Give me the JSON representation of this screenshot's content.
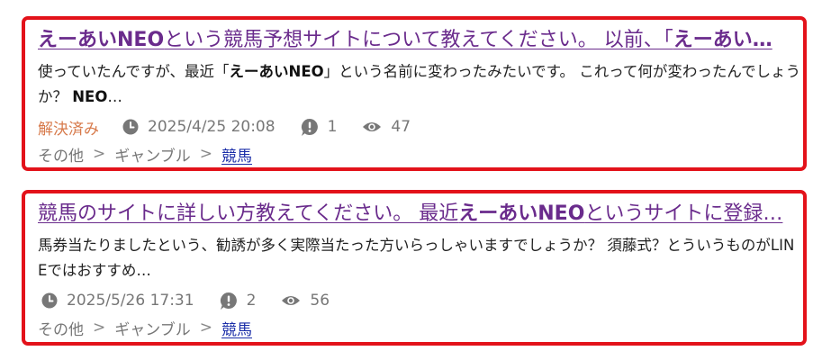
{
  "questions": [
    {
      "title_parts": [
        {
          "text": "えーあいNEO",
          "bold": true
        },
        {
          "text": "という競馬予想サイトについて教えてください。 以前、「",
          "bold": false
        },
        {
          "text": "えーあい…",
          "bold": true
        }
      ],
      "body_parts": [
        {
          "text": "使っていたんですが、最近「",
          "bold": false
        },
        {
          "text": "えーあいNEO",
          "bold": true
        },
        {
          "text": "」という名前に変わったみたいです。 これって何が変わったんでしょうか？ ",
          "bold": false
        },
        {
          "text": "NEO",
          "bold": true
        },
        {
          "text": "…",
          "bold": false
        }
      ],
      "status": "解決済み",
      "datetime": "2025/4/25 20:08",
      "answers": "1",
      "views": "47",
      "breadcrumb": [
        "その他",
        "ギャンブル",
        "競馬"
      ]
    },
    {
      "title_parts": [
        {
          "text": "競馬のサイトに詳しい方教えてください。 最近",
          "bold": false
        },
        {
          "text": "えーあいNEO",
          "bold": true
        },
        {
          "text": "というサイトに登録…",
          "bold": false
        }
      ],
      "body_parts": [
        {
          "text": "馬券当たりましたという、勧誘が多く実際当たった方いらっしゃいますでしょうか？ 須藤式？とういうものがLINEではおすすめ…",
          "bold": false
        }
      ],
      "status": "",
      "datetime": "2025/5/26 17:31",
      "answers": "2",
      "views": "56",
      "breadcrumb": [
        "その他",
        "ギャンブル",
        "競馬"
      ]
    }
  ],
  "breadcrumb_separator": ">",
  "colors": {
    "border": "#e3121a",
    "title": "#6a2b8c",
    "link": "#1a2da8",
    "resolved": "#d77a4b",
    "meta": "#777777"
  },
  "icons": {
    "time": "clock-icon",
    "answers": "answer-bubble-icon",
    "views": "eye-icon"
  }
}
